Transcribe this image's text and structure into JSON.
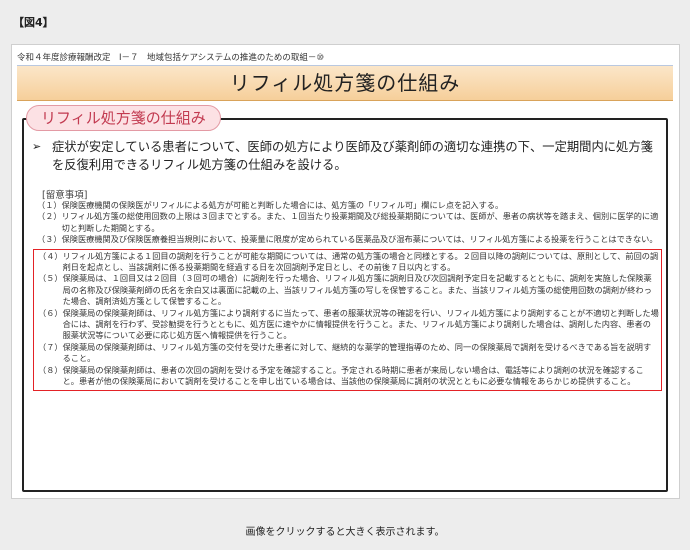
{
  "figure_label": "【図4】",
  "slide": {
    "header": "令和４年度診療報酬改定　Ⅰ－７　地域包括ケアシステムの推進のための取組－⑩",
    "title": "リフィル処方箋の仕組み",
    "section_pill": "リフィル処方箋の仕組み",
    "bullet": "症状が安定している患者について、医師の処方により医師及び薬剤師の適切な連携の下、一定期間内に処方箋を反復利用できるリフィル処方箋の仕組みを設ける。",
    "notes_heading": "[留意事項]",
    "notes": [
      {
        "num": "（１）",
        "text": "保険医療機関の保険医がリフィルによる処方が可能と判断した場合には、処方箋の「リフィル可」欄にレ点を記入する。"
      },
      {
        "num": "（２）",
        "text": "リフィル処方箋の総使用回数の上限は３回までとする。また、１回当たり投薬期間及び総投薬期間については、医師が、患者の病状等を踏まえ、個別に医学的に適切と判断した期間とする。"
      },
      {
        "num": "（３）",
        "text": "保険医療機関及び保険医療養担当規則において、投薬量に限度が定められている医薬品及び湿布薬については、リフィル処方箋による投薬を行うことはできない。"
      }
    ],
    "highlighted_notes": [
      {
        "num": "（４）",
        "text": "リフィル処方箋による１回目の調剤を行うことが可能な期間については、通常の処方箋の場合と同様とする。２回目以降の調剤については、原則として、前回の調剤日を起点とし、当該調剤に係る投薬期間を経過する日を次回調剤予定日とし、その前後７日以内とする。"
      },
      {
        "num": "（５）",
        "text": "保険薬局は、１回目又は２回目（３回可の場合）に調剤を行った場合、リフィル処方箋に調剤日及び次回調剤予定日を記載するとともに、調剤を実施した保険薬局の名称及び保険薬剤師の氏名を余白又は裏面に記載の上、当該リフィル処方箋の写しを保管すること。また、当該リフィル処方箋の総使用回数の調剤が終わった場合、調剤済処方箋として保管すること。"
      },
      {
        "num": "（６）",
        "text": "保険薬局の保険薬剤師は、リフィル処方箋により調剤するに当たって、患者の服薬状況等の確認を行い、リフィル処方箋により調剤することが不適切と判断した場合には、調剤を行わず、受診勧奨を行うとともに、処方医に速やかに情報提供を行うこと。また、リフィル処方箋により調剤した場合は、調剤した内容、患者の服薬状況等について必要に応じ処方医へ情報提供を行うこと。"
      },
      {
        "num": "（７）",
        "text": "保険薬局の保険薬剤師は、リフィル処方箋の交付を受けた患者に対して、継続的な薬学的管理指導のため、同一の保険薬局で調剤を受けるべきである旨を説明すること。"
      },
      {
        "num": "（８）",
        "text": "保険薬局の保険薬剤師は、患者の次回の調剤を受ける予定を確認すること。予定される時期に患者が来局しない場合は、電話等により調剤の状況を確認すること。患者が他の保険薬局において調剤を受けることを申し出ている場合は、当該他の保険薬局に調剤の状況とともに必要な情報をあらかじめ提供すること。"
      }
    ]
  },
  "caption": "画像をクリックすると大きく表示されます。",
  "colors": {
    "highlight_border": "#e32226",
    "pill_text": "#c23a50",
    "title_band": "#f6cf9a"
  }
}
